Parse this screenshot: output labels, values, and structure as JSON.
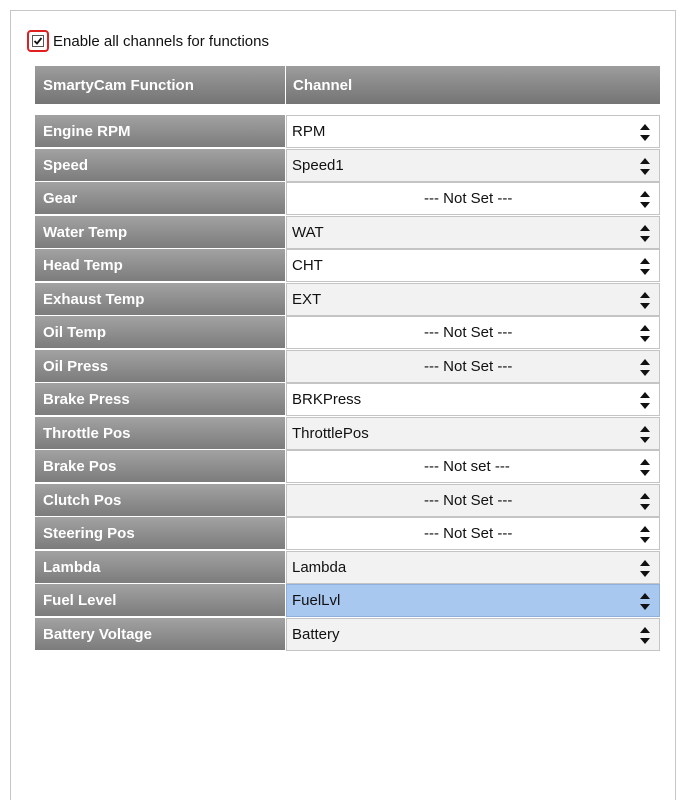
{
  "enable_all": {
    "label": "Enable all channels for functions",
    "checked": true
  },
  "headers": {
    "function": "SmartyCam Function",
    "channel": "Channel"
  },
  "rows": [
    {
      "function": "Engine RPM",
      "channel": "RPM"
    },
    {
      "function": "Speed",
      "channel": "Speed1"
    },
    {
      "function": "Gear",
      "channel": "--- Not Set ---"
    },
    {
      "function": "Water Temp",
      "channel": "WAT"
    },
    {
      "function": "Head Temp",
      "channel": "CHT"
    },
    {
      "function": "Exhaust Temp",
      "channel": "EXT"
    },
    {
      "function": "Oil Temp",
      "channel": "--- Not Set ---"
    },
    {
      "function": "Oil Press",
      "channel": "--- Not Set ---"
    },
    {
      "function": "Brake Press",
      "channel": "BRKPress"
    },
    {
      "function": "Throttle Pos",
      "channel": "ThrottlePos"
    },
    {
      "function": "Brake Pos",
      "channel": "--- Not set ---"
    },
    {
      "function": "Clutch Pos",
      "channel": "--- Not Set ---"
    },
    {
      "function": "Steering Pos",
      "channel": "--- Not Set ---"
    },
    {
      "function": "Lambda",
      "channel": "Lambda"
    },
    {
      "function": "Fuel Level",
      "channel": "FuelLvl"
    },
    {
      "function": "Battery Voltage",
      "channel": "Battery"
    }
  ],
  "selected_row": "Fuel Level",
  "colors": {
    "header_gray": "#8a8a8a",
    "selected_highlight": "#a9c8f0",
    "checkbox_focus_ring": "#e02020"
  }
}
